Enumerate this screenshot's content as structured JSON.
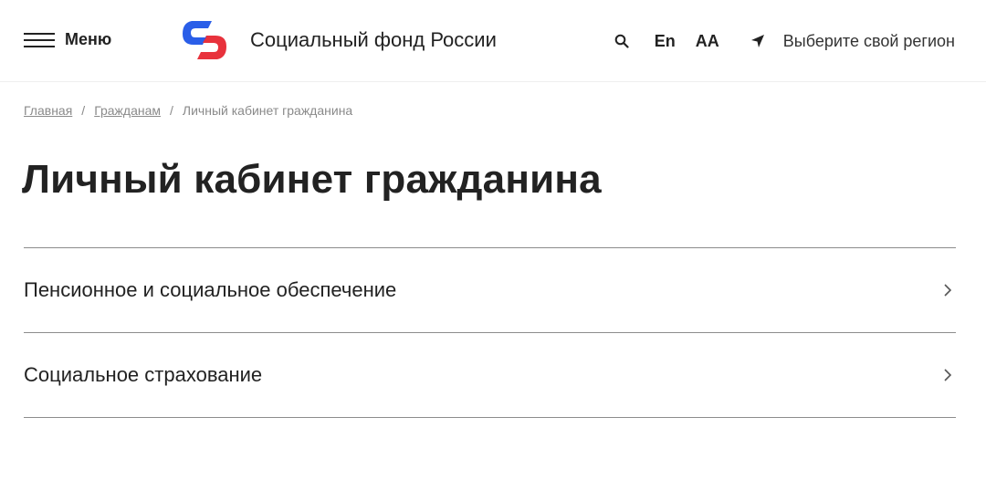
{
  "header": {
    "menu_label": "Меню",
    "logo_text": "Социальный фонд России",
    "lang_label": "En",
    "font_size_label": "AA",
    "region_label": "Выберите свой регион"
  },
  "breadcrumb": {
    "items": [
      "Главная",
      "Гражданам",
      "Личный кабинет гражданина"
    ],
    "separator": "/"
  },
  "page": {
    "title": "Личный кабинет гражданина"
  },
  "list": {
    "items": [
      {
        "label": "Пенсионное и социальное обеспечение"
      },
      {
        "label": "Социальное страхование"
      }
    ]
  },
  "colors": {
    "brand_blue": "#2a5ee8",
    "brand_red": "#e8323c",
    "text": "#222222",
    "muted": "#8a8a8a",
    "divider": "#8c8c8c"
  },
  "icons": {
    "menu": "hamburger-icon",
    "search": "search-icon",
    "region": "location-arrow-icon",
    "item_arrow": "chevron-right-icon"
  }
}
